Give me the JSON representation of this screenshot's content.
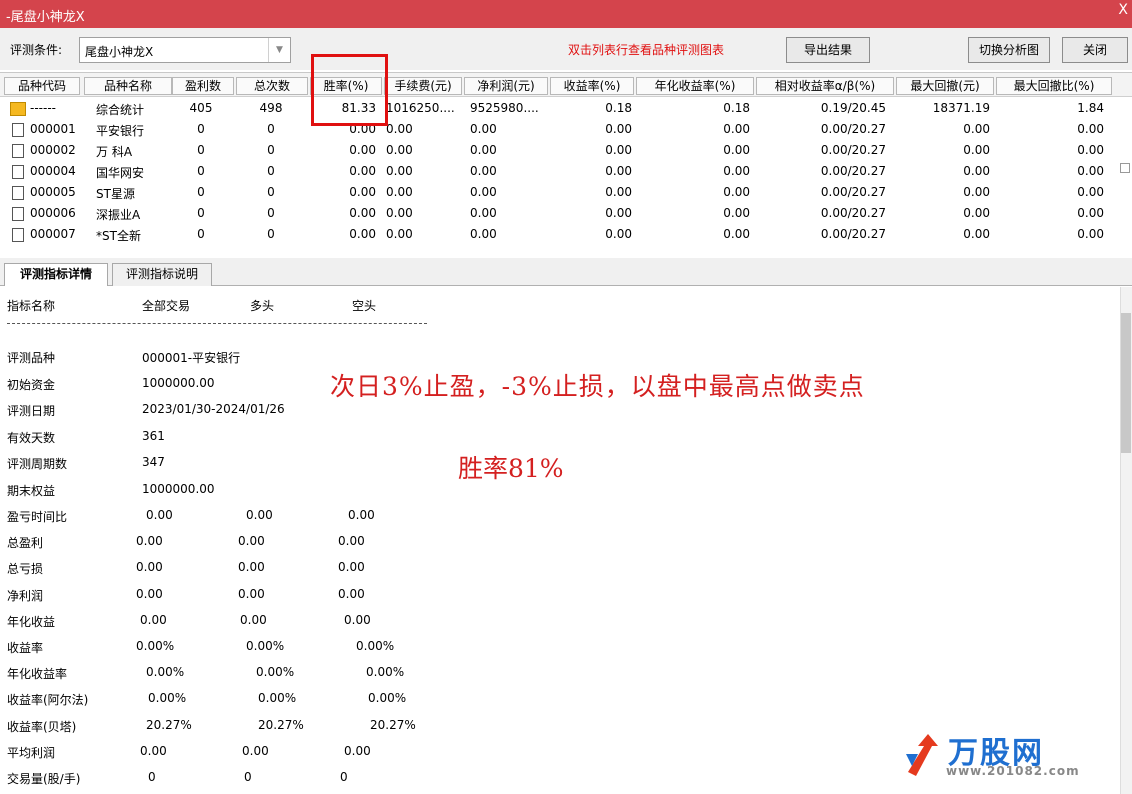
{
  "window": {
    "title": "-尾盘小神龙X",
    "close_glyph": "X"
  },
  "toolbar": {
    "condition_label": "评测条件:",
    "condition_value": "尾盘小神龙X",
    "hint": "双击列表行查看品种评测图表",
    "export_label": "导出结果",
    "switch_label": "切换分析图",
    "close_label": "关闭"
  },
  "table": {
    "columns": [
      "品种代码",
      "品种名称",
      "盈利数",
      "总次数",
      "胜率(%)",
      "手续费(元)",
      "净利润(元)",
      "收益率(%)",
      "年化收益率(%)",
      "相对收益率α/β(%)",
      "最大回撤(元)",
      "最大回撤比(%)"
    ],
    "rows": [
      [
        "------",
        "综合统计",
        "405",
        "498",
        "81.33",
        "1016250....",
        "9525980....",
        "0.18",
        "0.18",
        "0.19/20.45",
        "18371.19",
        "1.84"
      ],
      [
        "000001",
        "平安银行",
        "0",
        "0",
        "0.00",
        "0.00",
        "0.00",
        "0.00",
        "0.00",
        "0.00/20.27",
        "0.00",
        "0.00"
      ],
      [
        "000002",
        "万 科A",
        "0",
        "0",
        "0.00",
        "0.00",
        "0.00",
        "0.00",
        "0.00",
        "0.00/20.27",
        "0.00",
        "0.00"
      ],
      [
        "000004",
        "国华网安",
        "0",
        "0",
        "0.00",
        "0.00",
        "0.00",
        "0.00",
        "0.00",
        "0.00/20.27",
        "0.00",
        "0.00"
      ],
      [
        "000005",
        "ST星源",
        "0",
        "0",
        "0.00",
        "0.00",
        "0.00",
        "0.00",
        "0.00",
        "0.00/20.27",
        "0.00",
        "0.00"
      ],
      [
        "000006",
        "深振业A",
        "0",
        "0",
        "0.00",
        "0.00",
        "0.00",
        "0.00",
        "0.00",
        "0.00/20.27",
        "0.00",
        "0.00"
      ],
      [
        "000007",
        "*ST全新",
        "0",
        "0",
        "0.00",
        "0.00",
        "0.00",
        "0.00",
        "0.00",
        "0.00/20.27",
        "0.00",
        "0.00"
      ]
    ]
  },
  "tabs": [
    "评测指标详情",
    "评测指标说明"
  ],
  "details": {
    "headers": [
      "指标名称",
      "全部交易",
      "多头",
      "空头"
    ],
    "info": [
      [
        "评测品种",
        "000001-平安银行"
      ],
      [
        "初始资金",
        "1000000.00"
      ],
      [
        "评测日期",
        "2023/01/30-2024/01/26"
      ],
      [
        "有效天数",
        "361"
      ],
      [
        "评测周期数",
        "347"
      ],
      [
        "期末权益",
        "1000000.00"
      ]
    ],
    "metrics": [
      [
        "盈亏时间比",
        "0.00",
        "0.00",
        "0.00"
      ],
      [
        "总盈利",
        "0.00",
        "0.00",
        "0.00"
      ],
      [
        "总亏损",
        "0.00",
        "0.00",
        "0.00"
      ],
      [
        "净利润",
        "0.00",
        "0.00",
        "0.00"
      ],
      [
        "年化收益",
        "0.00",
        "0.00",
        "0.00"
      ],
      [
        "收益率",
        "0.00%",
        "0.00%",
        "0.00%"
      ],
      [
        "年化收益率",
        "0.00%",
        "0.00%",
        "0.00%"
      ],
      [
        "收益率(阿尔法)",
        "0.00%",
        "0.00%",
        "0.00%"
      ],
      [
        "收益率(贝塔)",
        "20.27%",
        "20.27%",
        "20.27%"
      ],
      [
        "平均利润",
        "0.00",
        "0.00",
        "0.00"
      ],
      [
        "交易量(股/手)",
        "0",
        "0",
        "0"
      ]
    ]
  },
  "annotations": {
    "line1": "次日3%止盈，-3%止损，以盘中最高点做卖点",
    "line2": "胜率81%"
  },
  "watermark": {
    "brand": "万股网",
    "url": "www.201082.com"
  },
  "colors": {
    "titlebar": "#d4444c",
    "highlight": "#e01010",
    "annotation": "#d42020"
  }
}
